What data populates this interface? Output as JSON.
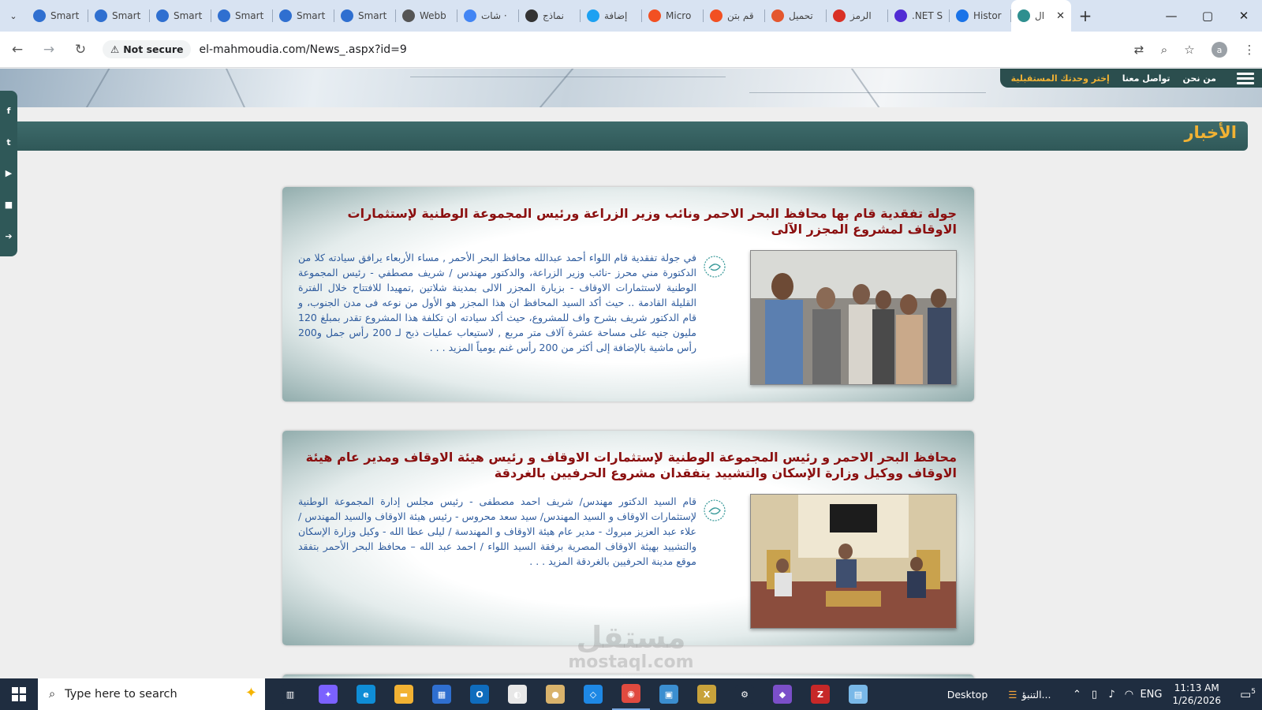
{
  "browser": {
    "tabs": [
      {
        "label": "Smart",
        "icon": "smart-icon",
        "color": "#2f6fd0"
      },
      {
        "label": "Smart",
        "icon": "smart-icon",
        "color": "#2f6fd0"
      },
      {
        "label": "Smart",
        "icon": "smart-icon",
        "color": "#2f6fd0"
      },
      {
        "label": "Smart",
        "icon": "smart-icon",
        "color": "#2f6fd0"
      },
      {
        "label": "Smart",
        "icon": "smart-icon",
        "color": "#2f6fd0"
      },
      {
        "label": "Smart",
        "icon": "smart-icon",
        "color": "#2f6fd0"
      },
      {
        "label": "Webb",
        "icon": "globe-icon",
        "color": "#555555"
      },
      {
        "label": "شات ·",
        "icon": "google-icon",
        "color": "#4285f4"
      },
      {
        "label": "نماذج",
        "icon": "openai-icon",
        "color": "#333333"
      },
      {
        "label": "إضافة",
        "icon": "circle-icon",
        "color": "#1da1f2"
      },
      {
        "label": "Micro",
        "icon": "microsoft-icon",
        "color": "#f25022"
      },
      {
        "label": "قم بتن",
        "icon": "microsoft-icon",
        "color": "#f25022"
      },
      {
        "label": "تحميل",
        "icon": "play-icon",
        "color": "#e4572e"
      },
      {
        "label": "الرمز",
        "icon": "gmail-icon",
        "color": "#d93025"
      },
      {
        "label": ".NET S",
        "icon": "dotnet-icon",
        "color": "#512bd4"
      },
      {
        "label": "Histor",
        "icon": "history-icon",
        "color": "#1a73e8"
      },
      {
        "label": "ال",
        "icon": "site-icon",
        "color": "#2f8f8f",
        "active": true
      }
    ],
    "new_tab": "+",
    "window_controls": [
      "—",
      "▢",
      "✕"
    ],
    "security_label": "Not secure",
    "url": "el-mahmoudia.com/News_.aspx?id=9",
    "profile_initial": "a"
  },
  "site": {
    "nav": {
      "about": "من نحن",
      "contact": "تواصل معنا",
      "future": "إختر وحدتك المستقبلية"
    },
    "section_title": "الأخبار",
    "social": [
      "f",
      "t",
      "▶",
      "■",
      "➔"
    ],
    "news": [
      {
        "title": "جولة تفقدية قام بها محافظ البحر الاحمر ونائب وزير الزراعة ورئيس المجموعة الوطنية لإستثمارات الاوقاف لمشروع المجزر الآلى",
        "body": "في جولة تفقدية قام اللواء أحمد عبدالله محافظ البحر الأحمر , مساء الأربعاء يرافق سيادته كلا من الدكتورة مني محرز -نائب وزير الزراعة، والدكتور مهندس / شريف مصطفي - رئيس المجموعة الوطنية لاستثمارات الاوقاف - بزيارة المجزر الالى بمدينة شلاتين ,تمهيدا للافتتاح خلال الفترة القليلة القادمة .. حيث أكد السيد المحافظ ان هذا المجزر هو الأول من نوعه فى مدن الجنوب، و قام الدكتور شريف بشرح واف للمشروع، حيث أكد سيادته ان تكلفة هذا المشروع تقدر بمبلغ 120 مليون جنيه على مساحة عشرة آلاف متر مربع , لاستيعاب عمليات ذبح لـ 200 رأس جمل و200 رأس ماشية بالإضافة إلى أكثر من 200 رأس غنم يومياً",
        "more": "المزيد . . ."
      },
      {
        "title": "محافظ البحر الاحمر و رئيس المجموعة الوطنية لإستثمارات الاوقاف و رئيس هيئة الاوقاف ومدير عام هيئة الاوقاف ووكيل وزارة الإسكان والتشييد يتفقدان مشروع الحرفيين بالغردقة",
        "body": "قام السيد الدكتور مهندس/ شريف احمد مصطفى - رئيس مجلس إدارة المجموعة الوطنية لإستثمارات الاوقاف و السيد المهندس/ سيد سعد محروس - رئيس هيئة الاوقاف والسيد المهندس / علاء عبد العزيز مبروك - مدير عام هيئة الاوقاف و المهندسة / ليلى عطا الله - وكيل وزارة الإسكان والتشييد بهيئة الاوقاف المصرية برفقة السيد اللواء / احمد عبد الله – محافظ البحر الأحمر بتفقد موقع مدينة الحرفيين بالغردقة",
        "more": "المزيد . . ."
      }
    ]
  },
  "watermark": {
    "main": "مستقل",
    "sub": "mostaql.com"
  },
  "taskbar": {
    "search_placeholder": "Type here to search",
    "apps": [
      {
        "name": "task-view-icon",
        "color": "#1f2d40",
        "glyph": "▥"
      },
      {
        "name": "copilot-icon",
        "color": "#7b61ff",
        "glyph": "✦"
      },
      {
        "name": "edge-icon",
        "color": "#0f8dd6",
        "glyph": "e"
      },
      {
        "name": "file-explorer-icon",
        "color": "#f2b233",
        "glyph": "▬"
      },
      {
        "name": "store-icon",
        "color": "#2f6fd0",
        "glyph": "▦"
      },
      {
        "name": "outlook-icon",
        "color": "#0f6cbd",
        "glyph": "O"
      },
      {
        "name": "paint-icon",
        "color": "#e8e8e8",
        "glyph": "◐"
      },
      {
        "name": "palette-icon",
        "color": "#d9b36c",
        "glyph": "●"
      },
      {
        "name": "vscode-icon",
        "color": "#1e88e5",
        "glyph": "◇"
      },
      {
        "name": "chrome-icon",
        "color": "#e04a3f",
        "glyph": "◉",
        "running": true
      },
      {
        "name": "desktop-app-icon",
        "color": "#3b8ed0",
        "glyph": "▣"
      },
      {
        "name": "excel-icon",
        "color": "#c8a23b",
        "glyph": "X"
      },
      {
        "name": "settings-icon",
        "color": "#1f2d40",
        "glyph": "⚙"
      },
      {
        "name": "visual-studio-icon",
        "color": "#7b4fc9",
        "glyph": "◆"
      },
      {
        "name": "filezilla-icon",
        "color": "#c62828",
        "glyph": "Z"
      },
      {
        "name": "notepad-icon",
        "color": "#79b8e8",
        "glyph": "▤"
      }
    ],
    "desktop_label": "Desktop",
    "weather_label": "التنبؤ...",
    "lang": "ENG",
    "time": "11:13 AM",
    "date": "1/26/2026",
    "notif_count": "5"
  }
}
